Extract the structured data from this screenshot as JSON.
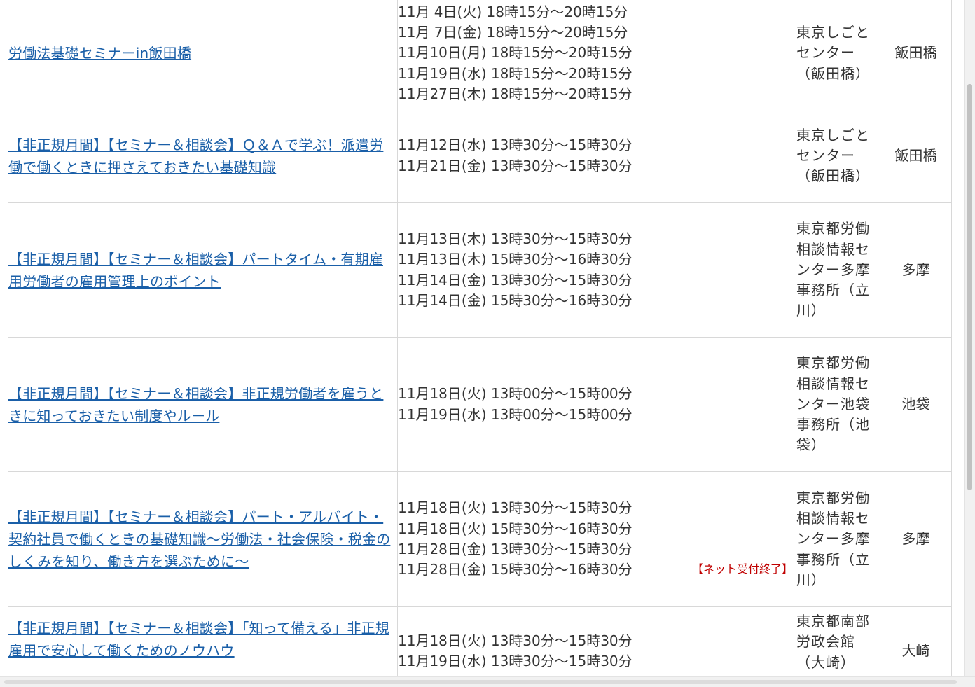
{
  "rows": [
    {
      "title": "労働法基礎セミナーin飯田橋",
      "dates": [
        "11月 4日(火) 18時15分～20時15分",
        "11月 7日(金) 18時15分～20時15分",
        "11月10日(月) 18時15分～20時15分",
        "11月19日(水) 18時15分～20時15分",
        "11月27日(木) 18時15分～20時15分"
      ],
      "venue": "東京しごとセンター（飯田橋）",
      "area": "飯田橋"
    },
    {
      "title": "【非正規月間】【セミナー＆相談会】Ｑ＆Ａで学ぶ！派遣労働で働くときに押さえておきたい基礎知識",
      "dates": [
        "11月12日(水) 13時30分～15時30分",
        "11月21日(金) 13時30分～15時30分"
      ],
      "venue": "東京しごとセンター（飯田橋）",
      "area": "飯田橋"
    },
    {
      "title": "【非正規月間】【セミナー＆相談会】パートタイム・有期雇用労働者の雇用管理上のポイント",
      "dates": [
        "11月13日(木) 13時30分～15時30分",
        "11月13日(木) 15時30分～16時30分",
        "11月14日(金) 13時30分～15時30分",
        "11月14日(金) 15時30分～16時30分"
      ],
      "venue": "東京都労働相談情報センター多摩事務所（立川）",
      "area": "多摩"
    },
    {
      "title": "【非正規月間】【セミナー＆相談会】非正規労働者を雇うときに知っておきたい制度やルール",
      "dates": [
        "11月18日(火) 13時00分～15時00分",
        "11月19日(水) 13時00分～15時00分"
      ],
      "venue": "東京都労働相談情報センター池袋事務所（池袋）",
      "area": "池袋"
    },
    {
      "title": "【非正規月間】【セミナー＆相談会】パート・アルバイト・契約社員で働くときの基礎知識～労働法・社会保険・税金のしくみを知り、働き方を選ぶために～",
      "dates": [
        "11月18日(火) 13時30分～15時30分",
        "11月18日(火) 15時30分～16時30分",
        "11月28日(金) 13時30分～15時30分",
        "11月28日(金) 15時30分～16時30分"
      ],
      "closed_note": "【ネット受付終了】",
      "venue": "東京都労働相談情報センター多摩事務所（立川）",
      "area": "多摩"
    },
    {
      "title": "【非正規月間】【セミナー＆相談会】「知って備える」非正規雇用で安心して働くためのノウハウ",
      "dates": [
        "11月18日(火) 13時30分～15時30分",
        "11月19日(水) 13時30分～15時30分"
      ],
      "venue": "東京都南部労政会館（大崎）",
      "area": "大崎"
    }
  ],
  "colors": {
    "link": "#1a5fa8",
    "text": "#333333",
    "closed_note": "#c00000",
    "border": "#d8d8d8"
  }
}
